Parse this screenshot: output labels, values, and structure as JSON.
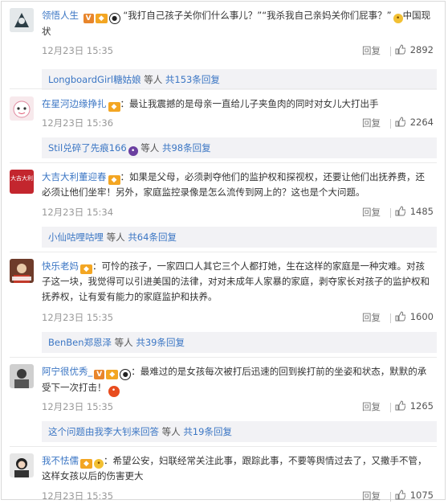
{
  "comments": [
    {
      "name": "领悟人生",
      "text": "“我打自己孩子关你们什么事儿？”“我杀我自己亲妈关你们屁事？”",
      "text2": "中国现状",
      "time": "12月23日 15:35",
      "reply": "回复",
      "likes": "2892",
      "sub": {
        "who": "LongboardGirl糖姑娘",
        "mid": " 等人 ",
        "count": "共153条回复"
      }
    },
    {
      "name": "在星河边缘挣扎",
      "text": "：最让我震撼的是母亲一直给儿子夹鱼肉的同时对女儿大打出手",
      "time": "12月23日 15:36",
      "reply": "回复",
      "likes": "2264",
      "sub": {
        "who": "Stil兑碎了先痕166",
        "mid": " 等人 ",
        "count": "共98条回复"
      }
    },
    {
      "name": "大吉大利董迎春",
      "text": "：如果是父母，必须剥夺他们的监护权和探视权，还要让他们出抚养费，还必须让他们坐牢！另外，家庭监控录像是怎么流传到网上的？这也是个大问题。",
      "avatar_text": "大吉大利",
      "time": "12月23日 15:34",
      "reply": "回复",
      "likes": "1485",
      "sub": {
        "who": "小仙咕哩咕哩",
        "mid": " 等人 ",
        "count": "共64条回复"
      }
    },
    {
      "name": "快乐老妈",
      "text": "：可怜的孩子，一家四口人其它三个人都打她，生在这样的家庭是一种灾难。对孩子这一块，我觉得可以引进美国的法律，对对未成年人家暴的家庭，剥夺家长对孩子的监护权和抚养权，让有爱有能力的家庭监护和扶养。",
      "time": "12月23日 15:35",
      "reply": "回复",
      "likes": "1600",
      "sub": {
        "who": "BenBen郑恩泽",
        "mid": " 等人 ",
        "count": "共39条回复"
      }
    },
    {
      "name": "阿宁很优秀_",
      "text": "：最难过的是女孩每次被打后迅速的回到挨打前的坐姿和状态，默默的承受下一次打击！",
      "time": "12月23日 15:35",
      "reply": "回复",
      "likes": "1265",
      "sub": {
        "who": "这个问题由我李大钊来回答",
        "mid": " 等人 ",
        "count": "共19条回复"
      }
    },
    {
      "name": "我不怯儒",
      "text": "：希望公安，妇联经常关注此事，跟踪此事，不要等舆情过去了，又撒手不管，这样女孩以后的伤害更大",
      "time": "12月23日 15:35",
      "reply": "回复",
      "likes": "1075"
    }
  ],
  "colors": {
    "link": "#3b76c4",
    "meta": "#999999",
    "subbg": "#f2f2f5"
  }
}
